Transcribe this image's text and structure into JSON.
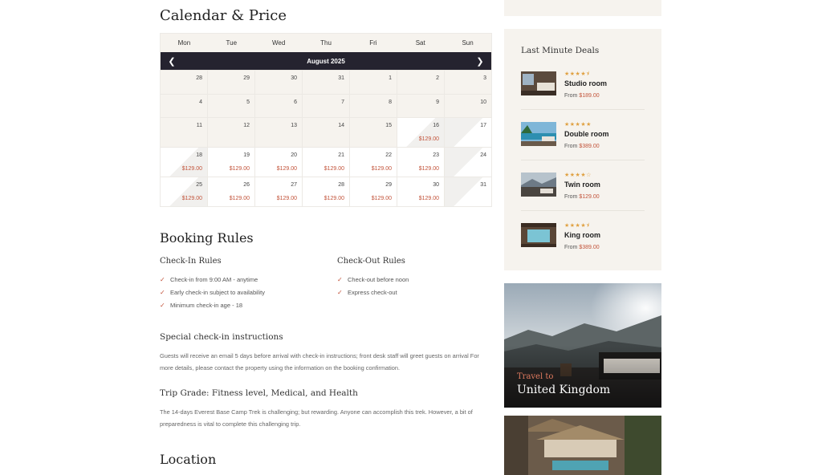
{
  "calendar": {
    "title": "Calendar & Price",
    "weekdays": [
      "Mon",
      "Tue",
      "Wed",
      "Thu",
      "Fri",
      "Sat",
      "Sun"
    ],
    "month_label": "August 2025",
    "prev_icon": "chevron-left-icon",
    "next_icon": "chevron-right-icon",
    "weeks": [
      [
        {
          "d": "28",
          "p": ""
        },
        {
          "d": "29",
          "p": ""
        },
        {
          "d": "30",
          "p": ""
        },
        {
          "d": "31",
          "p": ""
        },
        {
          "d": "1",
          "p": ""
        },
        {
          "d": "2",
          "p": ""
        },
        {
          "d": "3",
          "p": ""
        }
      ],
      [
        {
          "d": "4",
          "p": ""
        },
        {
          "d": "5",
          "p": ""
        },
        {
          "d": "6",
          "p": ""
        },
        {
          "d": "7",
          "p": ""
        },
        {
          "d": "8",
          "p": ""
        },
        {
          "d": "9",
          "p": ""
        },
        {
          "d": "10",
          "p": ""
        }
      ],
      [
        {
          "d": "11",
          "p": ""
        },
        {
          "d": "12",
          "p": ""
        },
        {
          "d": "13",
          "p": ""
        },
        {
          "d": "14",
          "p": ""
        },
        {
          "d": "15",
          "p": ""
        },
        {
          "d": "16",
          "p": "$129.00"
        },
        {
          "d": "17",
          "p": ""
        }
      ],
      [
        {
          "d": "18",
          "p": "$129.00"
        },
        {
          "d": "19",
          "p": "$129.00"
        },
        {
          "d": "20",
          "p": "$129.00"
        },
        {
          "d": "21",
          "p": "$129.00"
        },
        {
          "d": "22",
          "p": "$129.00"
        },
        {
          "d": "23",
          "p": "$129.00"
        },
        {
          "d": "24",
          "p": ""
        }
      ],
      [
        {
          "d": "25",
          "p": "$129.00"
        },
        {
          "d": "26",
          "p": "$129.00"
        },
        {
          "d": "27",
          "p": "$129.00"
        },
        {
          "d": "28",
          "p": "$129.00"
        },
        {
          "d": "29",
          "p": "$129.00"
        },
        {
          "d": "30",
          "p": "$129.00"
        },
        {
          "d": "31",
          "p": ""
        }
      ]
    ]
  },
  "booking_rules": {
    "title": "Booking Rules",
    "checkin_title": "Check-In Rules",
    "checkin_items": [
      "Check-in from 9:00 AM - anytime",
      "Early check-in subject to availability",
      "Minimum check-in age - 18"
    ],
    "checkout_title": "Check-Out Rules",
    "checkout_items": [
      "Check-out before noon",
      "Express check-out"
    ],
    "check_icon": "check-icon"
  },
  "special": {
    "title": "Special check-in instructions",
    "text": "Guests will receive an email 5 days before arrival with check-in instructions; front desk staff will greet guests on arrival For more details, please contact the property using the information on the booking confirmation."
  },
  "trip_grade": {
    "title": "Trip Grade: Fitness level, Medical, and Health",
    "text": "The 14-days Everest Base Camp Trek is challenging; but rewarding. Anyone can accomplish this trek. However, a bit of preparedness is vital to complete this challenging trip."
  },
  "location": {
    "title": "Location"
  },
  "sidebar": {
    "deals_title": "Last Minute Deals",
    "from_label": "From",
    "deals": [
      {
        "name": "Studio room",
        "price": "$189.00",
        "rating": 4.5,
        "stars": "★★★★⯨"
      },
      {
        "name": "Double room",
        "price": "$389.00",
        "rating": 5,
        "stars": "★★★★★"
      },
      {
        "name": "Twin room",
        "price": "$129.00",
        "rating": 4,
        "stars": "★★★★☆"
      },
      {
        "name": "King room",
        "price": "$389.00",
        "rating": 4.5,
        "stars": "★★★★⯨"
      }
    ],
    "promo": {
      "subtitle": "Travel to",
      "title": "United Kingdom"
    }
  },
  "colors": {
    "accent": "#c2533a",
    "star": "#e0a142",
    "dark_bar": "#25232f",
    "panel": "#f6f3ee"
  }
}
